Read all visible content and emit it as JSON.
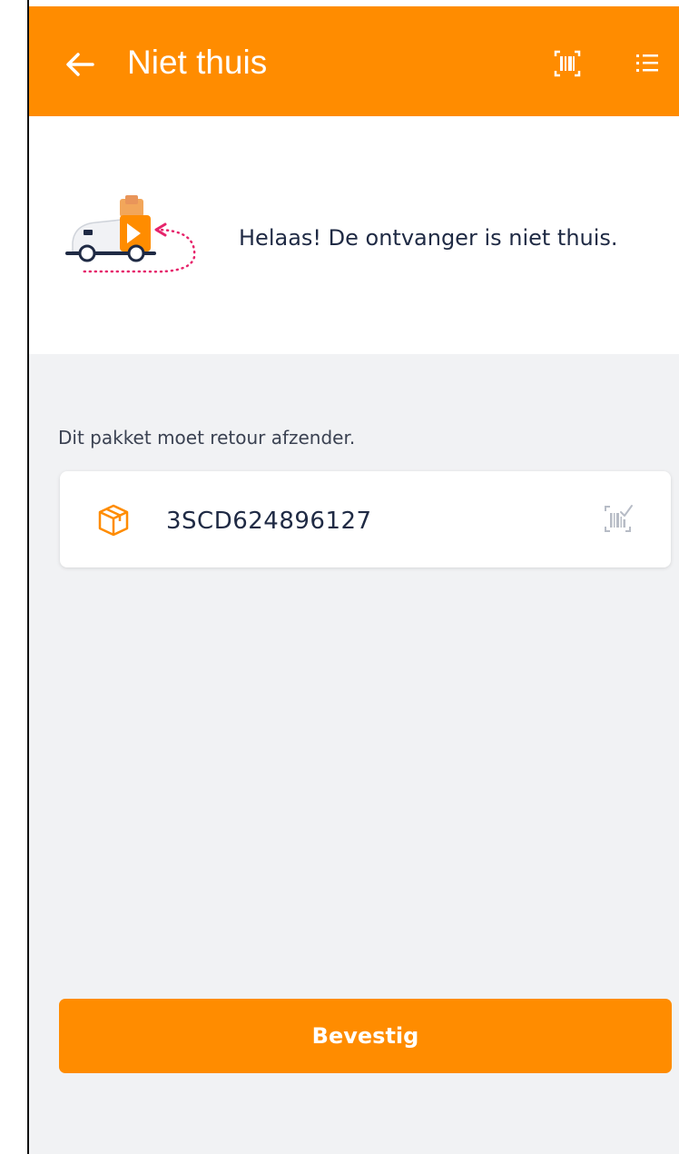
{
  "header": {
    "title": "Niet thuis",
    "back_icon": "arrow-left-icon",
    "actions": [
      {
        "icon": "barcode-scan-icon"
      },
      {
        "icon": "list-icon"
      }
    ],
    "background_color": "#ff8c00"
  },
  "banner": {
    "illustration": "delivery-van-return-icon",
    "message": "Helaas! De ontvanger is niet thuis."
  },
  "content": {
    "section_label": "Dit pakket moet retour afzender.",
    "parcel": {
      "icon": "package-box-icon",
      "code": "3SCD624896127",
      "status_icon": "barcode-check-icon"
    }
  },
  "footer": {
    "confirm_label": "Bevestig",
    "button_color": "#ff8c00"
  }
}
